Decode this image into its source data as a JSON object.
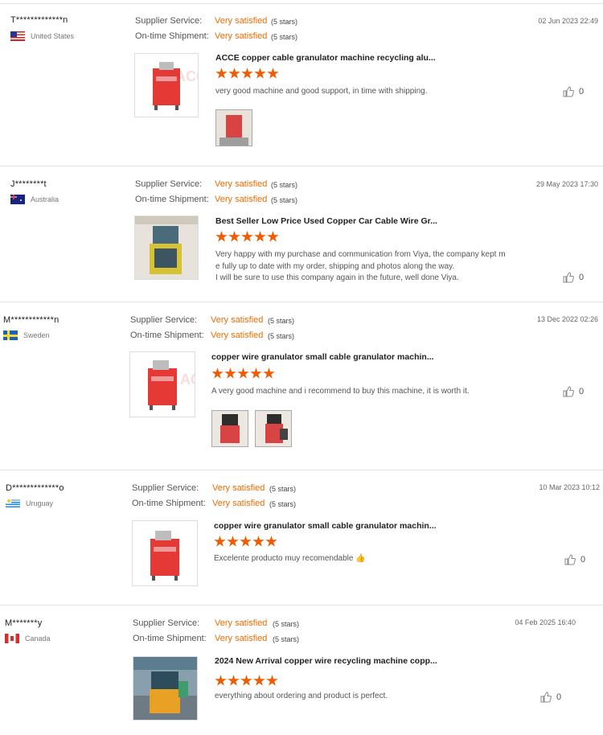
{
  "labels": {
    "supplier_service": "Supplier Service:",
    "ontime_shipment": "On-time Shipment:"
  },
  "colors": {
    "accent": "#f06b00",
    "star": "#f05a00",
    "machine_red": "#e53935"
  },
  "reviews": [
    {
      "user": "T*************n",
      "country": "United States",
      "flag": "us-flag",
      "date": "02 Jun 2023 22:49",
      "supplier_rating": "Very satisfied",
      "supplier_stars": "(5 stars)",
      "shipment_rating": "Very satisfied",
      "shipment_stars": "(5 stars)",
      "product_title": "ACCE copper cable granulator machine recycling alu...",
      "rating": 5,
      "comment": "very good machine and good support, in time with shipping.",
      "likes": "0",
      "watermark": "ACCE"
    },
    {
      "user": "J********t",
      "country": "Australia",
      "flag": "australia-flag",
      "date": "29 May 2023 17:30",
      "supplier_rating": "Very satisfied",
      "supplier_stars": "(5 stars)",
      "shipment_rating": "Very satisfied",
      "shipment_stars": "(5 stars)",
      "product_title": "Best Seller Low Price Used Copper Car Cable Wire Gr...",
      "rating": 5,
      "comment": "Very happy with my purchase and communication from Viya, the company kept m\ne fully up to date with my order, shipping and photos along the way.\nI will be sure to use this company again in the future, well done Viya.",
      "likes": "0"
    },
    {
      "user": "M************n",
      "country": "Sweden",
      "flag": "sweden-flag",
      "date": "13 Dec 2022 02:26",
      "supplier_rating": "Very satisfied",
      "supplier_stars": "(5 stars)",
      "shipment_rating": "Very satisfied",
      "shipment_stars": "(5 stars)",
      "product_title": "copper wire granulator small cable granulator machin...",
      "rating": 5,
      "comment": "A very good machine and i recommend to buy this machine, it is worth it.",
      "likes": "0",
      "watermark": "ACCE"
    },
    {
      "user": "D*************o",
      "country": "Uruguay",
      "flag": "uruguay-flag",
      "date": "10 Mar 2023 10:12",
      "supplier_rating": "Very satisfied",
      "supplier_stars": "(5 stars)",
      "shipment_rating": "Very satisfied",
      "shipment_stars": "(5 stars)",
      "product_title": "copper wire granulator small cable granulator machin...",
      "rating": 5,
      "comment": "Excelente producto muy recomendable 👍",
      "likes": "0"
    },
    {
      "user": "M*******y",
      "country": "Canada",
      "flag": "canada-flag",
      "date": "04 Feb 2025 16:40",
      "supplier_rating": "Very satisfied",
      "supplier_stars": "(5 stars)",
      "shipment_rating": "Very satisfied",
      "shipment_stars": "(5 stars)",
      "product_title": "2024 New Arrival copper wire recycling machine copp...",
      "rating": 5,
      "comment": "everything about ordering and product is perfect.",
      "likes": "0"
    }
  ]
}
